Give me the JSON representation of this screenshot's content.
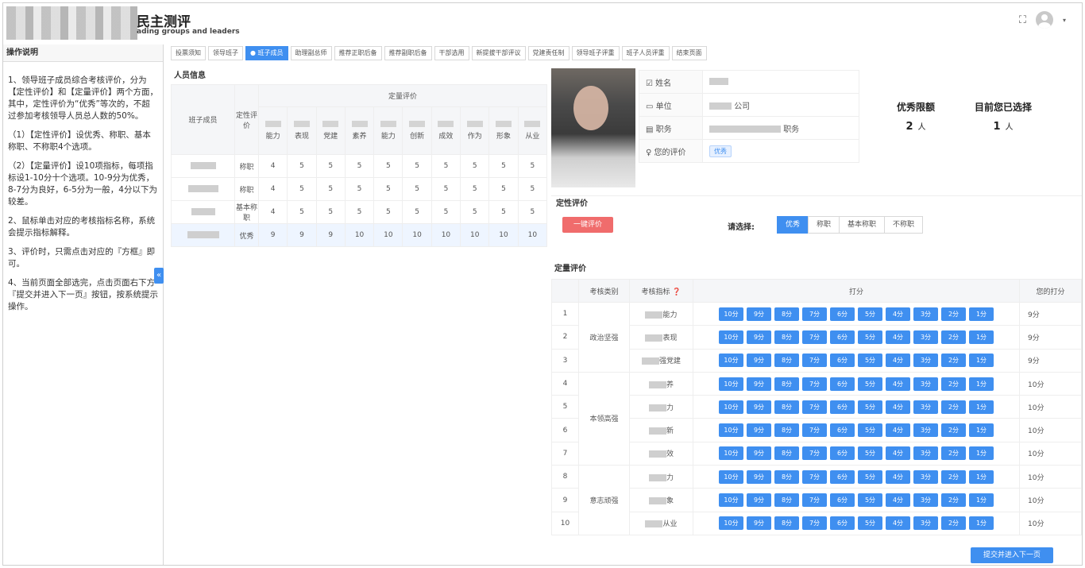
{
  "header": {
    "title": "民主测评",
    "subtitle": "ading groups and leaders",
    "expand_icon": "⛶",
    "user_caret": "▾"
  },
  "left_panel": {
    "title": "操作说明",
    "paragraphs": [
      "1、领导班子成员综合考核评价，分为【定性评价】和【定量评价】两个方面，其中，定性评价为“优秀”等次的，不超过参加考核领导人员总人数的50%。",
      "（1）【定性评价】设优秀、称职、基本称职、不称职4个选项。",
      "（2）【定量评价】设10项指标，每项指标设1-10分十个选项。10-9分为优秀，8-7分为良好，6-5分为一般，4分以下为较差。",
      "2、鼠标单击对应的考核指标名称，系统会提示指标解释。",
      "3、评价时，只需点击对应的『方框』即可。",
      "4、当前页面全部选完，点击页面右下方『提交并进入下一页』按钮，按系统提示操作。"
    ],
    "collapse_label": "«"
  },
  "tabs": [
    {
      "label": "投票须知",
      "active": false
    },
    {
      "label": "领导班子",
      "active": false
    },
    {
      "label": "● 班子成员",
      "active": true
    },
    {
      "label": "助理副总师",
      "active": false
    },
    {
      "label": "推荐正职后备",
      "active": false
    },
    {
      "label": "推荐副职后备",
      "active": false
    },
    {
      "label": "干部选用",
      "active": false
    },
    {
      "label": "新提拔干部评议",
      "active": false
    },
    {
      "label": "党建责任制",
      "active": false
    },
    {
      "label": "领导班子评重",
      "active": false
    },
    {
      "label": "班子人员评重",
      "active": false
    },
    {
      "label": "结束页面",
      "active": false
    }
  ],
  "people": {
    "title": "人员信息",
    "col_member": "班子成员",
    "col_qual": "定性评价",
    "col_quant": "定量评价",
    "sub_cols": [
      "能力",
      "表现",
      "党建",
      "素养",
      "能力",
      "创新",
      "成效",
      "作为",
      "形象",
      "从业"
    ],
    "rows": [
      {
        "qual": "称职",
        "scores": [
          "4",
          "5",
          "5",
          "5",
          "5",
          "5",
          "5",
          "5",
          "5",
          "5"
        ],
        "highlight": false
      },
      {
        "qual": "称职",
        "scores": [
          "4",
          "5",
          "5",
          "5",
          "5",
          "5",
          "5",
          "5",
          "5",
          "5"
        ],
        "highlight": false
      },
      {
        "qual": "基本称职",
        "scores": [
          "4",
          "5",
          "5",
          "5",
          "5",
          "5",
          "5",
          "5",
          "5",
          "5"
        ],
        "highlight": false
      },
      {
        "qual": "优秀",
        "scores": [
          "9",
          "9",
          "9",
          "10",
          "10",
          "10",
          "10",
          "10",
          "10",
          "10"
        ],
        "highlight": true
      }
    ]
  },
  "profile": {
    "name_label": "姓名",
    "unit_label": "单位",
    "unit_value": "公司",
    "post_label": "职务",
    "post_value": "职务",
    "your_eval_label": "您的评价",
    "your_eval_value": "优秀"
  },
  "quota": {
    "limit_label": "优秀限额",
    "limit_value": "2",
    "selected_label": "目前您已选择",
    "selected_value": "1",
    "unit": "人"
  },
  "qualitative": {
    "title": "定性评价",
    "one_key": "一键评价",
    "choose_label": "请选择:",
    "options": [
      {
        "label": "优秀",
        "on": true
      },
      {
        "label": "称职",
        "on": false
      },
      {
        "label": "基本称职",
        "on": false
      },
      {
        "label": "不称职",
        "on": false
      }
    ]
  },
  "quantitative": {
    "title": "定量评价",
    "col_category": "考核类别",
    "col_indicator": "考核指标",
    "col_score": "打分",
    "col_your": "您的打分",
    "score_buttons": [
      "10分",
      "9分",
      "8分",
      "7分",
      "6分",
      "5分",
      "4分",
      "3分",
      "2分",
      "1分"
    ],
    "categories": [
      {
        "name": "政治坚强",
        "span": 3
      },
      {
        "name": "本领高强",
        "span": 4
      },
      {
        "name": "意志顽强",
        "span": 3
      }
    ],
    "rows": [
      {
        "no": "1",
        "indicator": "能力",
        "your": "9分"
      },
      {
        "no": "2",
        "indicator": "表现",
        "your": "9分"
      },
      {
        "no": "3",
        "indicator": "强党建",
        "your": "9分"
      },
      {
        "no": "4",
        "indicator": "养",
        "your": "10分"
      },
      {
        "no": "5",
        "indicator": "力",
        "your": "10分"
      },
      {
        "no": "6",
        "indicator": "新",
        "your": "10分"
      },
      {
        "no": "7",
        "indicator": "效",
        "your": "10分"
      },
      {
        "no": "8",
        "indicator": "力",
        "your": "10分"
      },
      {
        "no": "9",
        "indicator": "象",
        "your": "10分"
      },
      {
        "no": "10",
        "indicator": "从业",
        "your": "10分"
      }
    ]
  },
  "submit_label": "提交并进入下一页",
  "colors": {
    "primary": "#3f8ff0",
    "danger": "#f06c6c"
  }
}
